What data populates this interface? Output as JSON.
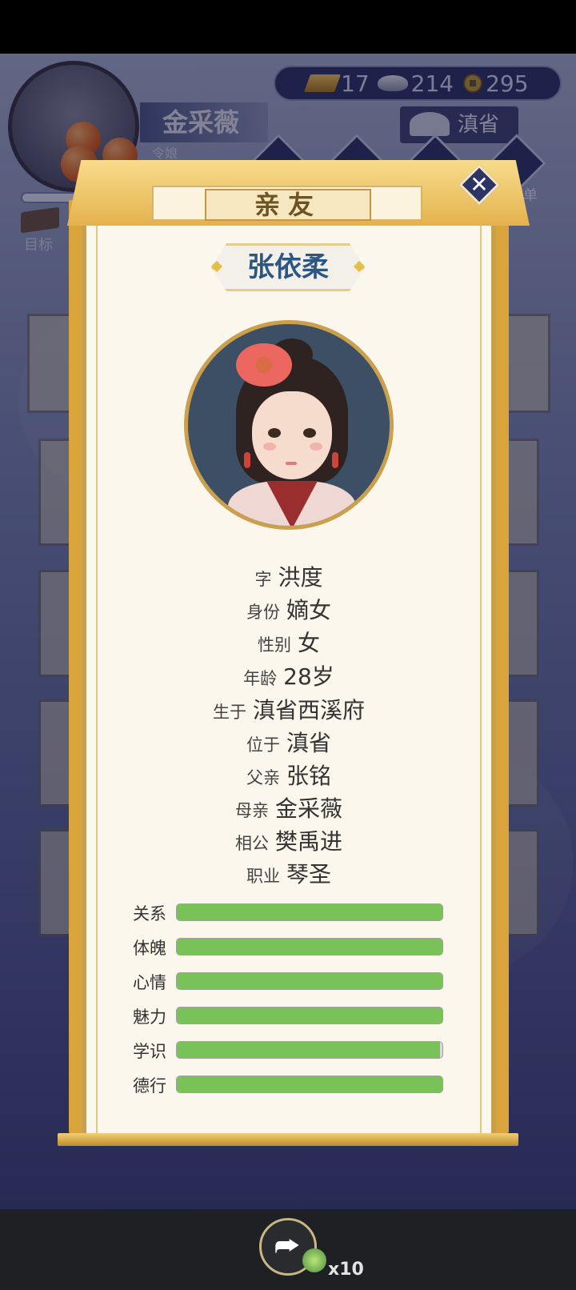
{
  "hud": {
    "player_name": "金采薇",
    "player_subtitle": "令娘",
    "target_label": "目标",
    "currency": {
      "gold": "17",
      "silver": "214",
      "coins": "295"
    },
    "province": "滇省",
    "menu_label": "菜单"
  },
  "dialog": {
    "title": "亲友",
    "close_symbol": "✕",
    "character_name": "张依柔",
    "info": [
      {
        "key": "字",
        "value": "洪度"
      },
      {
        "key": "身份",
        "value": "嫡女"
      },
      {
        "key": "性别",
        "value": "女"
      },
      {
        "key": "年龄",
        "value": "28岁"
      },
      {
        "key": "生于",
        "value": "滇省西溪府"
      },
      {
        "key": "位于",
        "value": "滇省"
      },
      {
        "key": "父亲",
        "value": "张铭"
      },
      {
        "key": "母亲",
        "value": "金采薇"
      },
      {
        "key": "相公",
        "value": "樊禹进"
      },
      {
        "key": "职业",
        "value": "琴圣"
      }
    ],
    "stats": [
      {
        "label": "关系",
        "fill": 1.0
      },
      {
        "label": "体魄",
        "fill": 1.0
      },
      {
        "label": "心情",
        "fill": 1.0
      },
      {
        "label": "魅力",
        "fill": 1.0
      },
      {
        "label": "学识",
        "fill": 0.99
      },
      {
        "label": "德行",
        "fill": 1.0
      }
    ],
    "stat_color": "#78c257"
  },
  "bottom": {
    "share_icon": "share-arrow-icon",
    "bonus_count": "x10"
  }
}
